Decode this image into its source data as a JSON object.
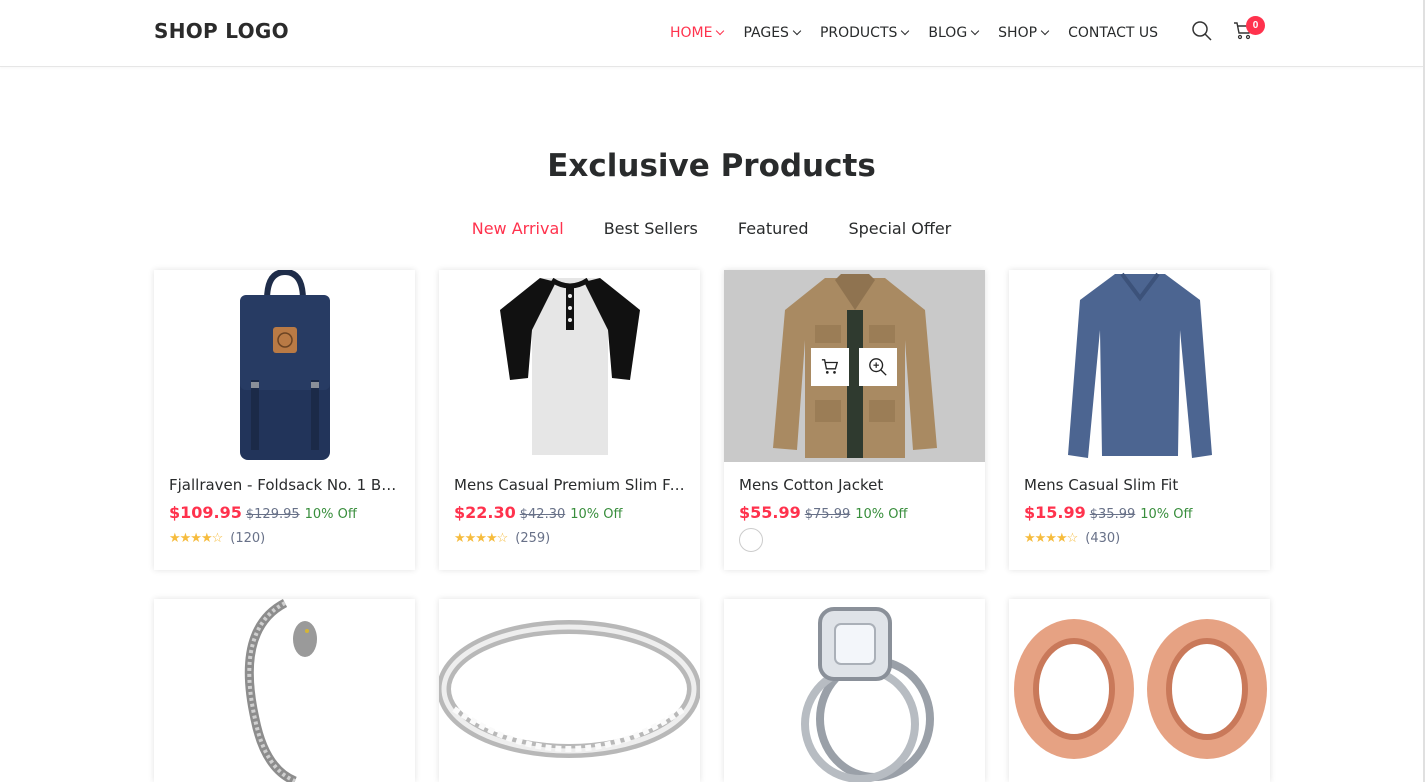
{
  "header": {
    "logo": "SHOP LOGO",
    "nav": [
      "HOME",
      "PAGES",
      "PRODUCTS",
      "BLOG",
      "SHOP",
      "CONTACT US"
    ],
    "cart_count": "0",
    "accent": "#ff324d"
  },
  "section": {
    "title": "Exclusive Products",
    "tabs": [
      "New Arrival",
      "Best Sellers",
      "Featured",
      "Special Offer"
    ],
    "active_tab": "New Arrival"
  },
  "products": [
    {
      "name": "Fjallraven - Foldsack No. 1 Bac…",
      "price": "$109.95",
      "old_price": "$129.95",
      "off": "10% Off",
      "reviews": "(120)",
      "image": "navy-backpack"
    },
    {
      "name": "Mens Casual Premium Slim Fi…",
      "price": "$22.30",
      "old_price": "$42.30",
      "off": "10% Off",
      "reviews": "(259)",
      "image": "raglan-henley-tshirt"
    },
    {
      "name": "Mens Cotton Jacket",
      "price": "$55.99",
      "old_price": "$75.99",
      "off": "10% Off",
      "image": "brown-cotton-jacket"
    },
    {
      "name": "Mens Casual Slim Fit",
      "price": "$15.99",
      "old_price": "$35.99",
      "off": "10% Off",
      "reviews": "(430)",
      "image": "blue-longsleeve-shirt"
    },
    {
      "image": "silver-dragon-bracelet"
    },
    {
      "image": "silver-eternity-ring"
    },
    {
      "image": "diamond-halo-ring-set"
    },
    {
      "image": "rose-gold-ear-tunnels"
    }
  ],
  "icons": {
    "search": "search-icon",
    "cart": "cart-icon",
    "star": "star-icon"
  },
  "colors": {
    "price": "#ff324d",
    "discount": "#388e3c",
    "star": "#f6bc3e"
  }
}
